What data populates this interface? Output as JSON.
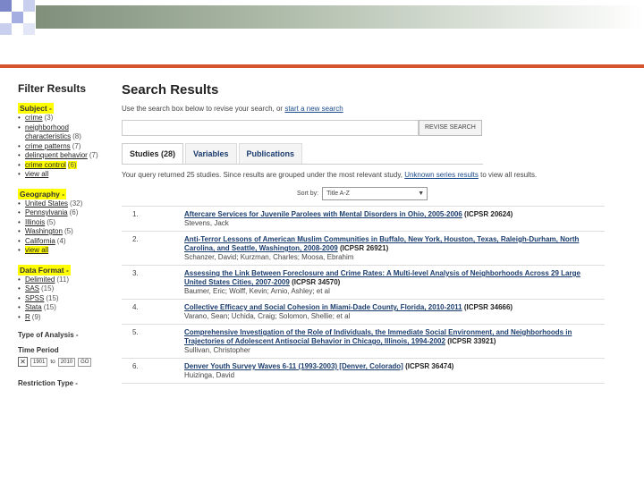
{
  "colors": {
    "accent_line": "#d6552f",
    "link": "#1a4a8a",
    "highlight": "#ffff00"
  },
  "filters": {
    "title": "Filter Results",
    "subject": {
      "label": "Subject -",
      "items": [
        {
          "label": "crime",
          "count": "(3)"
        },
        {
          "label": "neighborhood characteristics",
          "count": "(8)"
        },
        {
          "label": "crime patterns",
          "count": "(7)"
        },
        {
          "label": "delinquent behavior",
          "count": "(7)"
        },
        {
          "label": "crime control",
          "count": "(6)"
        },
        {
          "label": "view all",
          "count": ""
        }
      ]
    },
    "geography": {
      "label": "Geography -",
      "items": [
        {
          "label": "United States",
          "count": "(32)"
        },
        {
          "label": "Pennsylvania",
          "count": "(6)"
        },
        {
          "label": "Illinois",
          "count": "(5)"
        },
        {
          "label": "Washington",
          "count": "(5)"
        },
        {
          "label": "California",
          "count": "(4)"
        },
        {
          "label": "view all",
          "count": ""
        }
      ]
    },
    "data_format": {
      "label": "Data Format -",
      "items": [
        {
          "label": "Delimited",
          "count": "(11)"
        },
        {
          "label": "SAS",
          "count": "(15)"
        },
        {
          "label": "SPSS",
          "count": "(15)"
        },
        {
          "label": "Stata",
          "count": "(15)"
        },
        {
          "label": "R",
          "count": "(9)"
        }
      ]
    },
    "type_of_analysis": "Type of Analysis -",
    "time_period": {
      "label": "Time Period",
      "from": "1901",
      "to_word": "to",
      "to": "2010",
      "go": "GO"
    },
    "restriction_type": "Restriction Type -"
  },
  "main": {
    "title": "Search Results",
    "intro_text": "Use the search box below to revise your search, or",
    "intro_link": "start a new search",
    "search": {
      "value": "",
      "button": "REVISE SEARCH"
    },
    "tabs": [
      "Studies (28)",
      "Variables",
      "Publications"
    ],
    "note_text": "Your query returned 25 studies. Since results are grouped under the most relevant study,",
    "note_link": "Unknown series results",
    "note_text2": "to view all results.",
    "sort": {
      "label": "Sort by:",
      "value": "Title A-Z"
    },
    "results": [
      {
        "num": "1.",
        "title": "Aftercare Services for Juvenile Parolees with Mental Disorders in Ohio, 2005-2006",
        "id": "(ICPSR 20624)",
        "authors": "Stevens, Jack"
      },
      {
        "num": "2.",
        "title": "Anti-Terror Lessons of American Muslim Communities in Buffalo, New York, Houston, Texas, Raleigh-Durham, North Carolina, and Seattle, Washington, 2008-2009",
        "id": "(ICPSR 26921)",
        "authors": "Schanzer, David; Kurzman, Charles; Moosa, Ebrahim"
      },
      {
        "num": "3.",
        "title": "Assessing the Link Between Foreclosure and Crime Rates: A Multi-level Analysis of Neighborhoods Across 29 Large United States Cities, 2007-2009",
        "id": "(ICPSR 34570)",
        "authors": "Baumer, Eric; Wolff, Kevin; Arnio, Ashley; et al"
      },
      {
        "num": "4.",
        "title": "Collective Efficacy and Social Cohesion in Miami-Dade County, Florida, 2010-2011",
        "id": "(ICPSR 34666)",
        "authors": "Varano, Sean; Uchida, Craig; Solomon, Shellie; et al"
      },
      {
        "num": "5.",
        "title": "Comprehensive Investigation of the Role of Individuals, the Immediate Social Environment, and Neighborhoods in Trajectories of Adolescent Antisocial Behavior in Chicago, Illinois, 1994-2002",
        "id": "(ICPSR 33921)",
        "authors": "Sullivan, Christopher"
      },
      {
        "num": "6.",
        "title": "Denver Youth Survey Waves 6-11 (1993-2003) [Denver, Colorado]",
        "id": "(ICPSR 36474)",
        "authors": "Huizinga, David"
      }
    ]
  }
}
